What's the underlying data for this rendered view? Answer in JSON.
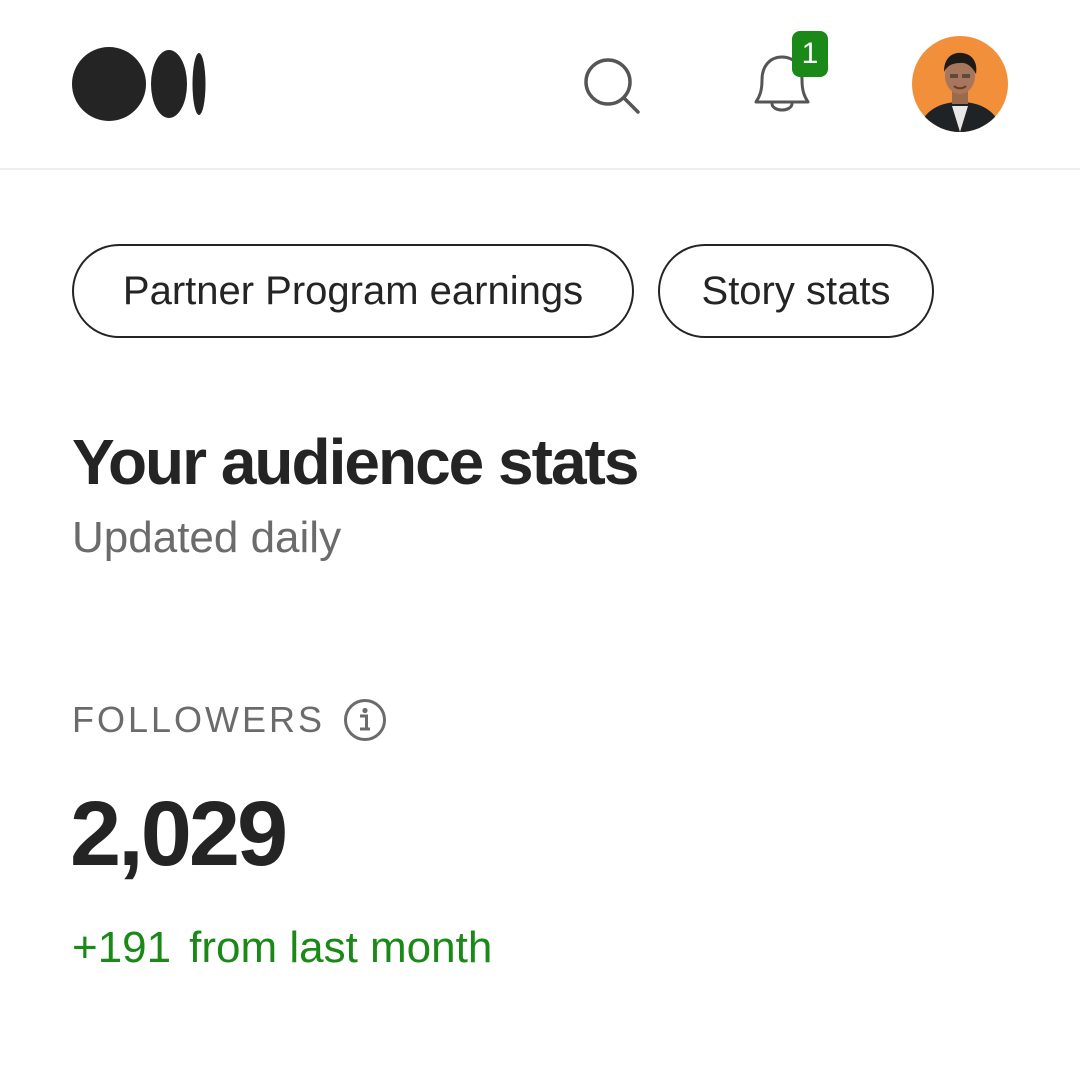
{
  "header": {
    "logo_icon": "medium-logo-icon",
    "search_icon": "search-icon",
    "notifications_icon": "bell-icon",
    "notification_count": "1",
    "avatar": "user-avatar"
  },
  "tabs": [
    {
      "label": "Partner Program earnings"
    },
    {
      "label": "Story stats"
    }
  ],
  "main": {
    "title": "Your audience stats",
    "subtitle": "Updated daily",
    "followers": {
      "label": "FOLLOWERS",
      "info_icon": "info-icon",
      "count": "2,029",
      "change": "+191",
      "change_suffix": "from last month"
    }
  },
  "colors": {
    "text": "#242424",
    "muted": "#6b6b6b",
    "accent_green": "#1a8917",
    "avatar_bg": "#f18f3b"
  }
}
